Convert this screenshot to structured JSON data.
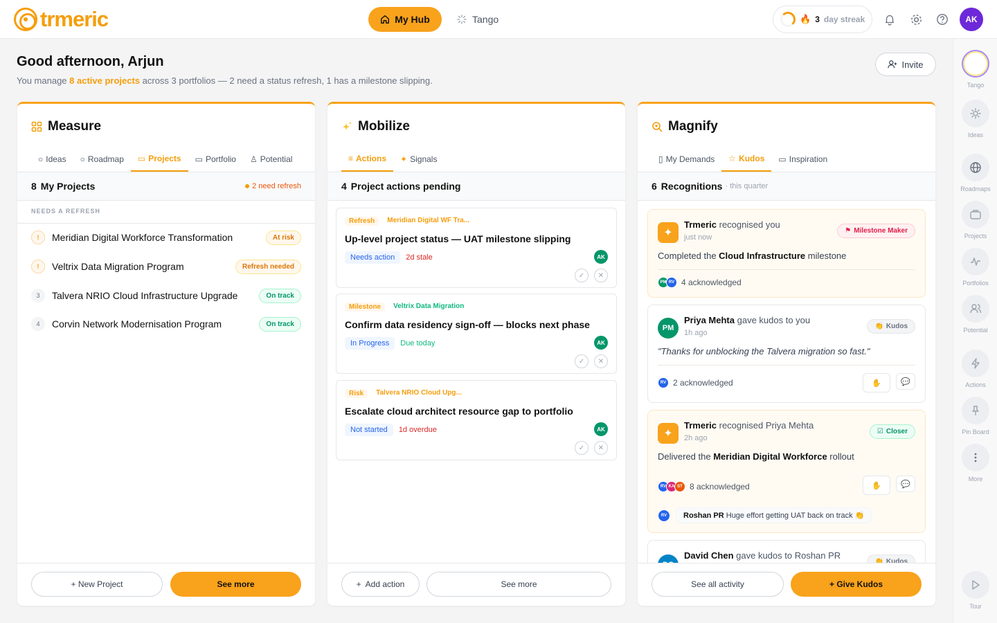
{
  "app": {
    "logo_text": "trmeric",
    "brand_color": "#f59e0b",
    "accent_color": "#f9a21b"
  },
  "topnav": {
    "hub_label": "My Hub",
    "tango_label": "Tango",
    "streak_num": "3",
    "streak_label": "day streak",
    "user_initials": "AK"
  },
  "rail": [
    {
      "label": "Tango",
      "icon": "tango-orb-icon"
    },
    {
      "label": "Ideas",
      "icon": "lightbulb-icon"
    },
    {
      "label": "Roadmaps",
      "icon": "globe-icon"
    },
    {
      "label": "Projects",
      "icon": "briefcase-icon"
    },
    {
      "label": "Portfolios",
      "icon": "pulse-icon"
    },
    {
      "label": "Potential",
      "icon": "users-icon"
    },
    {
      "label": "Actions",
      "icon": "bolt-icon"
    },
    {
      "label": "Pin Board",
      "icon": "pin-icon"
    },
    {
      "label": "More",
      "icon": "more-vertical-icon"
    },
    {
      "label": "Tour",
      "icon": "play-icon"
    }
  ],
  "greeting": {
    "title": "Good afternoon, Arjun",
    "sub_pre": "You manage ",
    "sub_highlight": "8 active projects",
    "sub_post": " across 3 portfolios — 2 need a status refresh, 1 has a milestone slipping.",
    "invite_label": "Invite"
  },
  "measure": {
    "title": "Measure",
    "tabs": [
      "Ideas",
      "Roadmap",
      "Projects",
      "Portfolio",
      "Potential"
    ],
    "active_tab": "Projects",
    "count": "8",
    "header_label": "My Projects",
    "refresh_label": "2 need refresh",
    "section_label": "NEEDS A REFRESH",
    "projects": [
      {
        "num": "!",
        "name": "Meridian Digital Workforce Transformation",
        "status": "At risk",
        "tone": "orange",
        "warn": true
      },
      {
        "num": "!",
        "name": "Veltrix Data Migration Program",
        "status": "Refresh needed",
        "tone": "orange",
        "warn": true
      },
      {
        "num": "3",
        "name": "Talvera NRIO Cloud Infrastructure Upgrade",
        "status": "On track",
        "tone": "green",
        "warn": false
      },
      {
        "num": "4",
        "name": "Corvin Network Modernisation Program",
        "status": "On track",
        "tone": "green",
        "warn": false
      }
    ],
    "new_project_label": "+ New Project",
    "see_more_label": "See more"
  },
  "mobilize": {
    "title": "Mobilize",
    "tabs": [
      "Actions",
      "Signals"
    ],
    "active_tab": "Actions",
    "count": "4",
    "header_label": "Project actions pending",
    "actions": [
      {
        "type": "Refresh",
        "project": "Meridian Digital WF Tra...",
        "project_tone": "orange",
        "title": "Up-level project status — UAT milestone slipping",
        "status": "Needs action",
        "due": "2d stale",
        "due_tone": "red",
        "assignee": "AK"
      },
      {
        "type": "Milestone",
        "project": "Veltrix Data Migration",
        "project_tone": "green",
        "title": "Confirm data residency sign-off — blocks next phase",
        "status": "In Progress",
        "due": "Due today",
        "due_tone": "green",
        "assignee": "AK"
      },
      {
        "type": "Risk",
        "project": "Talvera NRIO Cloud Upg...",
        "project_tone": "orange",
        "title": "Escalate cloud architect resource gap to portfolio",
        "status": "Not started",
        "due": "1d overdue",
        "due_tone": "red",
        "assignee": "AK"
      }
    ],
    "add_label": "Add action",
    "see_more_label": "See more"
  },
  "magnify": {
    "title": "Magnify",
    "tabs": [
      "My Demands",
      "Kudos",
      "Inspiration"
    ],
    "active_tab": "Kudos",
    "count": "6",
    "header_label": "Recognitions",
    "header_sub": "· this quarter",
    "cards": [
      {
        "actor": "Trmeric",
        "verb": "recognised you",
        "time": "just now",
        "badge": "Milestone Maker",
        "body_pre": "Completed the ",
        "body_bold": "Cloud Infrastructure",
        "body_post": " milestone",
        "ack": "4 acknowledged"
      },
      {
        "actor": "Priya Mehta",
        "verb": "gave kudos to you",
        "time": "1h ago",
        "badge": "Kudos",
        "initials": "PM",
        "quote": "\"Thanks for unblocking the Talvera migration so fast.\"",
        "ack": "2 acknowledged"
      },
      {
        "actor": "Trmeric",
        "verb": "recognised Priya Mehta",
        "time": "2h ago",
        "badge": "Closer",
        "body_pre": "Delivered the ",
        "body_bold": "Meridian Digital Workforce",
        "body_post": " rollout",
        "ack": "8 acknowledged",
        "comment_author": "Roshan PR",
        "comment_text": "Huge effort getting UAT back on track 👏"
      },
      {
        "actor": "David Chen",
        "verb": "gave kudos to Roshan PR",
        "badge": "Kudos",
        "initials": "DC"
      }
    ],
    "see_all_label": "See all activity",
    "give_label": "+ Give Kudos"
  }
}
